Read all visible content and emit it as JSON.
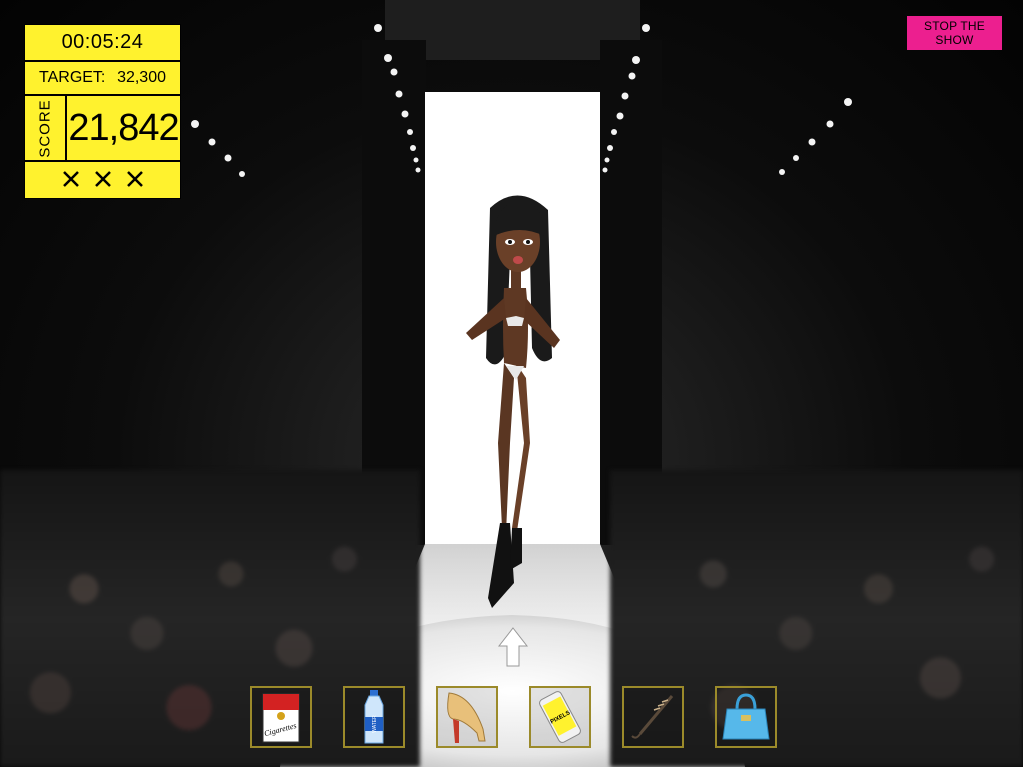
{
  "hud": {
    "timer": "00:05:24",
    "target_label": "TARGET:",
    "target_value": "32,300",
    "score_label": "SCORE",
    "score_value": "21,842",
    "strikes": [
      "x-mark-icon",
      "x-mark-icon",
      "x-mark-icon"
    ]
  },
  "stop_button": {
    "label": "STOP THE SHOW",
    "color": "#ec1f8f"
  },
  "colors": {
    "hud_yellow": "#fff22e",
    "slot_border": "#9b8a2a"
  },
  "items": [
    {
      "name": "cigarettes",
      "icon": "cigarette-pack-icon",
      "label": "Cigarettes"
    },
    {
      "name": "water",
      "icon": "water-bottle-icon",
      "label": "WATER"
    },
    {
      "name": "heels",
      "icon": "high-heel-icon"
    },
    {
      "name": "phone",
      "icon": "phone-icon",
      "label": "PIXELS"
    },
    {
      "name": "umbrella",
      "icon": "umbrella-icon"
    },
    {
      "name": "handbag",
      "icon": "handbag-icon"
    }
  ],
  "runway_arrow": {
    "icon": "up-arrow-icon"
  }
}
